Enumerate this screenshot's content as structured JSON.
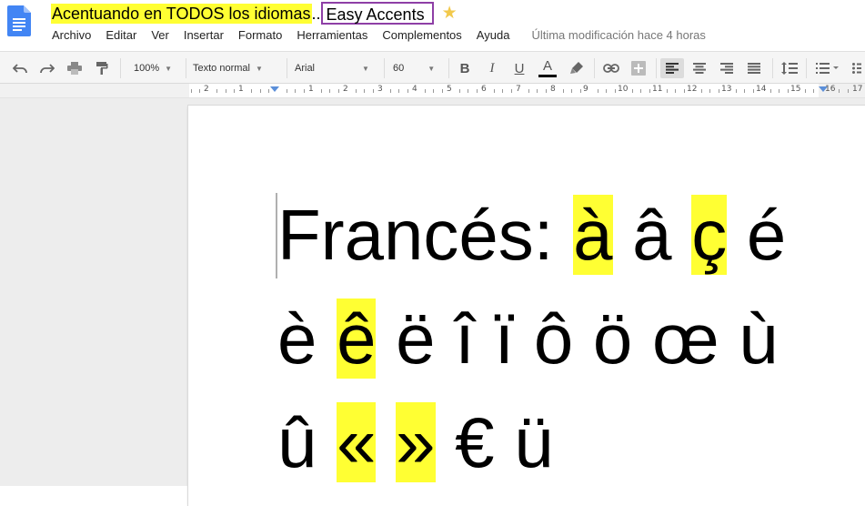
{
  "header": {
    "doc_title": "Acentuando en TODOS los idiomas",
    "title_separator": "..",
    "addon_name": "Easy Accents",
    "star_icon": "star-icon",
    "menu": [
      "Archivo",
      "Editar",
      "Ver",
      "Insertar",
      "Formato",
      "Herramientas",
      "Complementos",
      "Ayuda"
    ],
    "last_modified": "Última modificación hace 4 horas"
  },
  "toolbar": {
    "zoom": "100%",
    "style": "Texto normal",
    "font": "Arial",
    "font_size": "60",
    "bold": "B",
    "italic": "I",
    "underline": "U",
    "text_color": "A",
    "text_color_value": "#000000"
  },
  "ruler": {
    "numbers": [
      "2",
      "1",
      "1",
      "2",
      "3",
      "4",
      "5",
      "6",
      "7",
      "8",
      "9",
      "10",
      "11",
      "12",
      "13",
      "14",
      "15",
      "16",
      "17"
    ]
  },
  "document": {
    "line1": [
      "Francés: ",
      "à",
      " â ",
      "ç",
      " é"
    ],
    "line2": [
      "è ",
      "ê",
      " ë î ï ô ö œ ù"
    ],
    "line3": [
      "û ",
      "«",
      " ",
      "»",
      " € ü"
    ]
  },
  "colors": {
    "highlight": "#ffff33",
    "addon_box_border": "#8e3fa6",
    "star": "#f2c94c",
    "docs_blue": "#4285f4"
  }
}
